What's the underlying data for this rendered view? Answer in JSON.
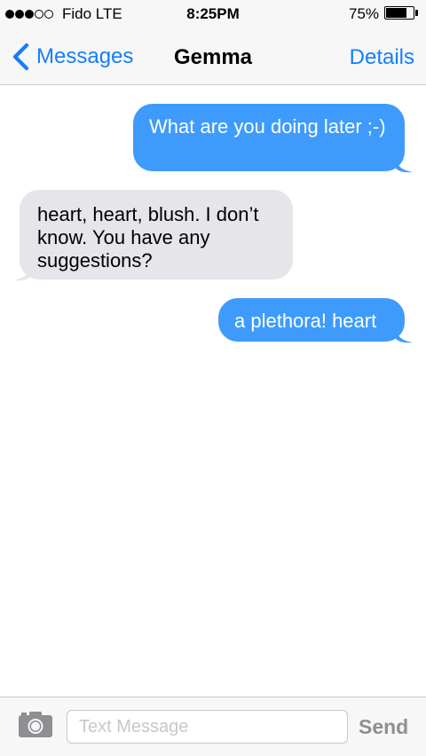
{
  "status_bar": {
    "signal_icon": "signal-strength-icon",
    "signal_bars_filled": 3,
    "signal_bars_total": 5,
    "carrier": "Fido  LTE",
    "time": "8:25PM",
    "battery_percent": "75%",
    "battery_level": 0.75,
    "battery_icon": "battery-icon"
  },
  "nav": {
    "back_icon": "chevron-left-icon",
    "back_label": "Messages",
    "title": "Gemma",
    "details_label": "Details"
  },
  "messages": [
    {
      "direction": "outgoing",
      "text": "What are you doing later ;-)"
    },
    {
      "direction": "incoming",
      "text": "heart, heart, blush. I don’t know. You have any suggestions?"
    },
    {
      "direction": "outgoing",
      "text": "a plethora! heart"
    }
  ],
  "input_bar": {
    "camera_icon": "camera-icon",
    "placeholder": "Text Message",
    "value": "",
    "send_label": "Send"
  },
  "colors": {
    "accent": "#157efb",
    "outgoing_bubble": "#3e9bfb",
    "incoming_bubble": "#e5e5ea",
    "bar_background": "#f7f7f8",
    "send_disabled": "#8e8e93"
  }
}
